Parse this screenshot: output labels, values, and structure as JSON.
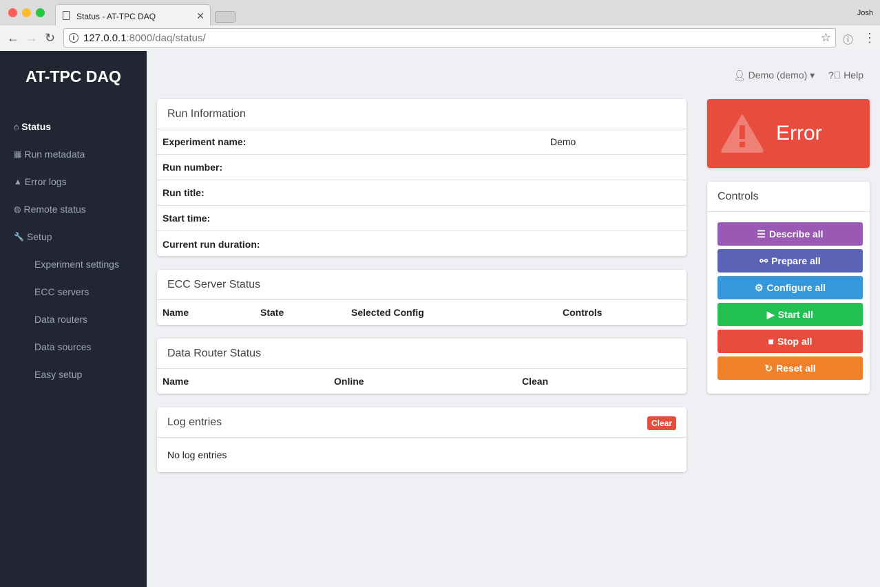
{
  "browser": {
    "tab_title": "Status - AT-TPC DAQ",
    "user": "Josh",
    "url_host": "127.0.0.1",
    "url_path": ":8000/daq/status/"
  },
  "sidebar": {
    "brand": "AT-TPC DAQ",
    "items": [
      {
        "label": "Status",
        "icon": "home-icon",
        "glyph": "⌂",
        "active": true
      },
      {
        "label": "Run metadata",
        "icon": "table-icon",
        "glyph": "▦"
      },
      {
        "label": "Error logs",
        "icon": "warning-icon",
        "glyph": "▲"
      },
      {
        "label": "Remote status",
        "icon": "dashboard-icon",
        "glyph": "◍"
      },
      {
        "label": "Setup",
        "icon": "wrench-icon",
        "glyph": "🔧"
      }
    ],
    "subitems": [
      "Experiment settings",
      "ECC servers",
      "Data routers",
      "Data sources",
      "Easy setup"
    ]
  },
  "header": {
    "user_menu": "Demo (demo)",
    "help": "Help"
  },
  "run_info": {
    "title": "Run Information",
    "rows": [
      {
        "label": "Experiment name:",
        "value": "Demo"
      },
      {
        "label": "Run number:",
        "value": ""
      },
      {
        "label": "Run title:",
        "value": ""
      },
      {
        "label": "Start time:",
        "value": ""
      },
      {
        "label": "Current run duration:",
        "value": ""
      }
    ]
  },
  "ecc": {
    "title": "ECC Server Status",
    "columns": [
      "Name",
      "State",
      "Selected Config",
      "Controls"
    ]
  },
  "routers": {
    "title": "Data Router Status",
    "columns": [
      "Name",
      "Online",
      "Clean"
    ]
  },
  "log": {
    "title": "Log entries",
    "clear": "Clear",
    "empty": "No log entries"
  },
  "status": {
    "label": "Error",
    "color": "#e74c3c"
  },
  "controls": {
    "title": "Controls",
    "buttons": [
      {
        "label": "Describe all",
        "glyph": "☰",
        "icon": "list-icon",
        "color": "#9b59b6"
      },
      {
        "label": "Prepare all",
        "glyph": "⚯",
        "icon": "link-icon",
        "color": "#5b63b4"
      },
      {
        "label": "Configure all",
        "glyph": "⚙",
        "icon": "gear-icon",
        "color": "#3498db"
      },
      {
        "label": "Start all",
        "glyph": "▶",
        "icon": "play-icon",
        "color": "#22c152"
      },
      {
        "label": "Stop all",
        "glyph": "■",
        "icon": "stop-icon",
        "color": "#e74c3c"
      },
      {
        "label": "Reset all",
        "glyph": "↻",
        "icon": "refresh-icon",
        "color": "#f0812a"
      }
    ]
  }
}
